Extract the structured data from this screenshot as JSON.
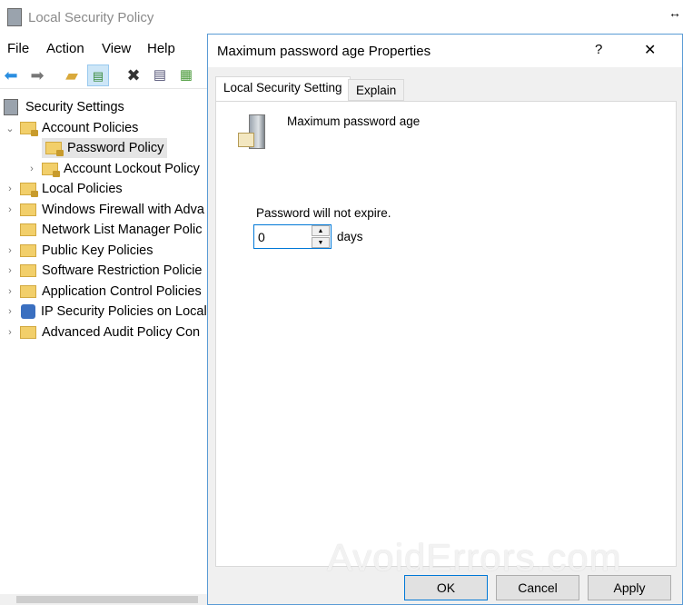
{
  "app": {
    "title": "Local Security Policy",
    "menu": [
      "File",
      "Action",
      "View",
      "Help"
    ],
    "toolbar_icons": [
      "back-icon",
      "forward-icon",
      "up-folder-icon",
      "show-hide-tree-icon",
      "delete-icon",
      "properties-icon",
      "export-list-icon"
    ],
    "tree": [
      {
        "label": "Security Settings",
        "level": 0,
        "expanded": true
      },
      {
        "label": "Account Policies",
        "level": 1,
        "expanded": true
      },
      {
        "label": "Password Policy",
        "level": 2,
        "selected": true
      },
      {
        "label": "Account Lockout Policy",
        "level": 2
      },
      {
        "label": "Local Policies",
        "level": 1
      },
      {
        "label": "Windows Firewall with Adva",
        "level": 1
      },
      {
        "label": "Network List Manager Polic",
        "level": 1
      },
      {
        "label": "Public Key Policies",
        "level": 1
      },
      {
        "label": "Software Restriction Policie",
        "level": 1
      },
      {
        "label": "Application Control Policies",
        "level": 1
      },
      {
        "label": "IP Security Policies on Local",
        "level": 1
      },
      {
        "label": "Advanced Audit Policy Con",
        "level": 1
      }
    ]
  },
  "dialog": {
    "title": "Maximum password age Properties",
    "help": "?",
    "close": "✕",
    "tabs": [
      "Local Security Setting",
      "Explain"
    ],
    "policy_name": "Maximum password age",
    "status": "Password will not expire.",
    "value": "0",
    "unit": "days",
    "buttons": {
      "ok": "OK",
      "cancel": "Cancel",
      "apply": "Apply"
    }
  },
  "watermark": "AvoidErrors.com",
  "colors": {
    "accent": "#0078d7"
  }
}
